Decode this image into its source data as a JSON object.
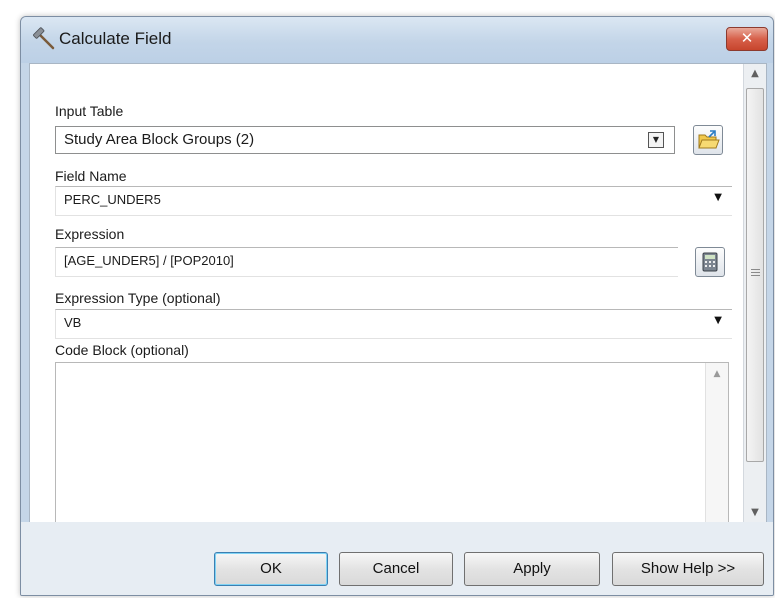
{
  "window": {
    "title": "Calculate Field",
    "close_label": "✕"
  },
  "icons": {
    "title": "hammer-icon",
    "browse": "open-folder-icon",
    "calculator": "calculator-icon",
    "close": "close-icon"
  },
  "form": {
    "input_table": {
      "label": "Input Table",
      "value": "Study Area Block Groups (2)"
    },
    "field_name": {
      "label": "Field Name",
      "value": "PERC_UNDER5"
    },
    "expression": {
      "label": "Expression",
      "value": "[AGE_UNDER5] / [POP2010]"
    },
    "expression_type": {
      "label": "Expression Type (optional)",
      "value": "VB"
    },
    "code_block": {
      "label": "Code Block (optional)",
      "value": ""
    }
  },
  "buttons": {
    "ok": "OK",
    "cancel": "Cancel",
    "apply": "Apply",
    "help": "Show Help >>"
  },
  "colors": {
    "title_bar": "#c3d5e8",
    "close_button": "#d7604a",
    "default_button_border": "#3c7fb1"
  }
}
